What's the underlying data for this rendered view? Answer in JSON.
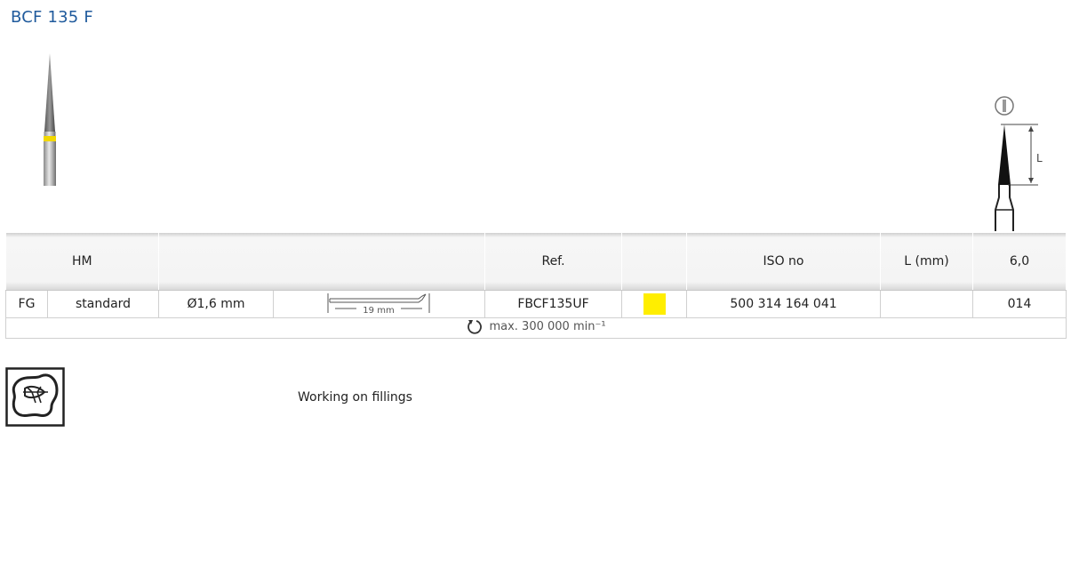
{
  "product": {
    "title": "BCF 135 F"
  },
  "table": {
    "headers": [
      "HM",
      "",
      "Ref.",
      "",
      "ISO no",
      "L (mm)",
      "6,0"
    ],
    "row": {
      "shank_type": "FG",
      "shank_variant": "standard",
      "shank_diameter": "Ø1,6 mm",
      "shank_length_label": "19 mm",
      "ref": "FBCF135UF",
      "color_ring": "#ffee00",
      "iso_no": "500 314 164 041",
      "length": "",
      "size": "014"
    },
    "max_speed": "max. 300 000 min⁻¹"
  },
  "application": {
    "icon": "filling-tooth-icon",
    "label": "Working on fillings"
  },
  "drawing": {
    "length_label": "L"
  }
}
